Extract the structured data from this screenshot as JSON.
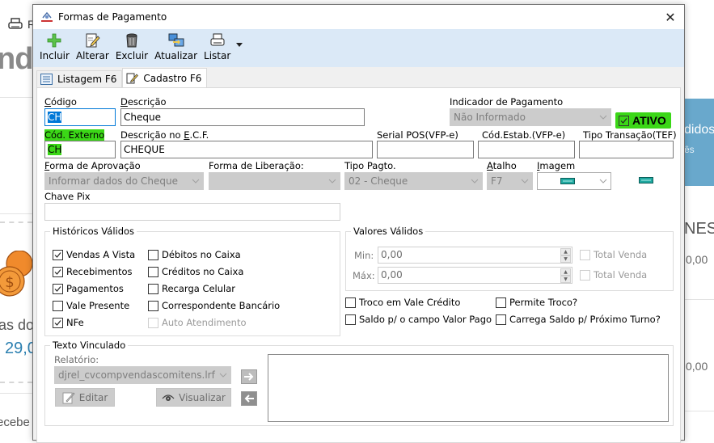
{
  "background": {
    "print_label": "R",
    "heading_fragment": "nd",
    "left_text_1": "as do",
    "left_amount": "29,0",
    "left_text_2": "ecebe",
    "right_card_title": "didos",
    "right_card_sub": "ês",
    "right_heading": "NES",
    "right_value_1": "0,00",
    "right_value_2": "0,00",
    "accent_blue": "#69a8cc",
    "coin_color": "#f08a2c"
  },
  "window": {
    "title": "Formas de Pagamento",
    "close_label": "✕"
  },
  "toolbar": {
    "buttons": [
      {
        "label": "Incluir",
        "icon": "plus-icon"
      },
      {
        "label": "Alterar",
        "icon": "edit-icon"
      },
      {
        "label": "Excluir",
        "icon": "trash-icon"
      },
      {
        "label": "Atualizar",
        "icon": "refresh-icon"
      },
      {
        "label": "Listar",
        "icon": "printer-icon"
      }
    ],
    "more_label": "▾"
  },
  "tabs": [
    {
      "label": "Listagem F6",
      "active": false
    },
    {
      "label": "Cadastro F6",
      "active": true
    }
  ],
  "form": {
    "codigo": {
      "label_pre": "",
      "label_u": "C",
      "label_post": "ódigo",
      "value": "CH"
    },
    "descricao": {
      "label_u": "D",
      "label_post": "escrição",
      "value": "Cheque"
    },
    "indicador_pagamento": {
      "label": "Indicador de Pagamento",
      "value": "Não Informado"
    },
    "ativo": {
      "label": "ATIVO",
      "checked": true
    },
    "cod_externo": {
      "label": "Cód. Externo",
      "value": "CH"
    },
    "descricao_ecf": {
      "label_pre": "Descrição no ",
      "label_u": "E",
      "label_post": ".C.F.",
      "value": "CHEQUE"
    },
    "serial_pos": {
      "label": "Serial POS(VFP-e)",
      "value": ""
    },
    "cod_estab": {
      "label": "Cód.Estab.(VFP-e)",
      "value": ""
    },
    "tipo_transacao": {
      "label": "Tipo Transação(TEF)",
      "value": ""
    },
    "forma_aprovacao": {
      "label_u": "F",
      "label_post": "orma de Aprovação",
      "value": "Informar dados do Cheque"
    },
    "forma_liberacao": {
      "label": "Forma de Liberação:",
      "value": ""
    },
    "tipo_pagto": {
      "label": "Tipo Pagto.",
      "value": "02 - Cheque"
    },
    "atalho": {
      "label_u": "A",
      "label_post": "talho",
      "value": "F7"
    },
    "imagem": {
      "label_u": "I",
      "label_post": "magem"
    },
    "chave_pix": {
      "label": "Chave Pix",
      "value": ""
    }
  },
  "historicos": {
    "title": "Históricos Válidos",
    "col1": [
      {
        "label": "Vendas A Vista",
        "checked": true
      },
      {
        "label": "Recebimentos",
        "checked": true
      },
      {
        "label": "Pagamentos",
        "checked": true
      },
      {
        "label": "Vale Presente",
        "checked": false
      },
      {
        "label": "NFe",
        "checked": true
      }
    ],
    "col2": [
      {
        "label": "Débitos no Caixa",
        "checked": false
      },
      {
        "label": "Créditos no Caixa",
        "checked": false
      },
      {
        "label": "Recarga Celular",
        "checked": false
      },
      {
        "label": "Correspondente Bancário",
        "checked": false
      },
      {
        "label": "Auto Atendimento",
        "checked": false,
        "disabled": true
      }
    ]
  },
  "valores": {
    "title": "Valores Válidos",
    "min_label": "Min:",
    "min_value": "0,00",
    "max_label": "Máx:",
    "max_value": "0,00",
    "total_venda_label": "Total Venda"
  },
  "options": [
    {
      "label": "Troco em Vale Crédito",
      "checked": false
    },
    {
      "label": "Permite Troco?",
      "checked": false
    },
    {
      "label": "Saldo p/ o campo Valor Pago",
      "checked": false
    },
    {
      "label": "Carrega Saldo p/ Próximo Turno?",
      "checked": false
    }
  ],
  "texto_vinculado": {
    "title": "Texto Vinculado",
    "relatorio_label": "Relatório:",
    "relatorio_value": "djrel_cvcompvendascomitens.lrf",
    "editar_label": "Editar",
    "visualizar_label": "Visualizar"
  },
  "colors": {
    "highlight_green": "#3bd717",
    "toolbar_bg": "#dbe9f7",
    "selection_blue": "#0078d7"
  }
}
